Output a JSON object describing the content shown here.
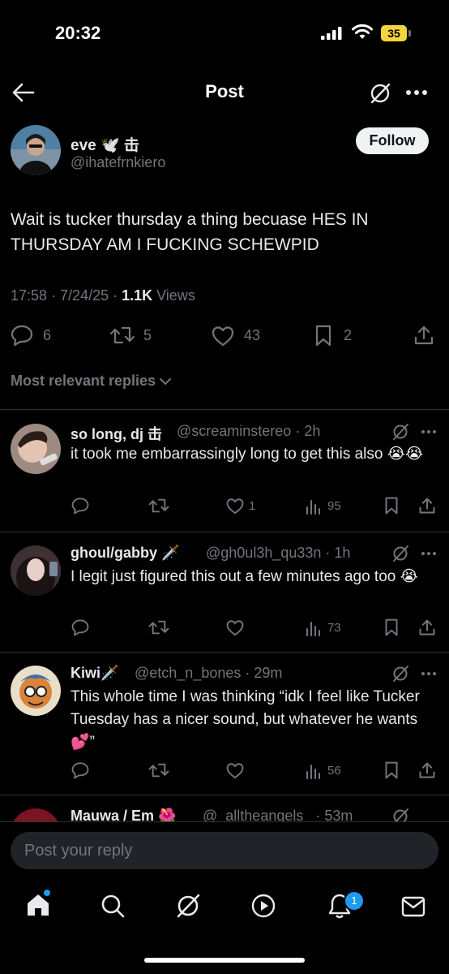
{
  "status_bar": {
    "time": "20:32",
    "battery": "35"
  },
  "header": {
    "title": "Post"
  },
  "post": {
    "name": "eve 🕊️ 击",
    "handle": "@ihatefrnkiero",
    "follow_label": "Follow",
    "text": "Wait is tucker thursday a thing becuase HES IN THURSDAY AM I FUCKING SCHEWPID",
    "timestamp": "17:58 · 7/24/25 · ",
    "views_count": "1.1K",
    "views_label": " Views",
    "stats": {
      "replies": "6",
      "reposts": "5",
      "likes": "43",
      "bookmarks": "2"
    }
  },
  "sort": {
    "label": "Most relevant replies"
  },
  "replies": [
    {
      "name": "so long, dj 击",
      "handle": "@screaminstereo · 2h",
      "text": "it took me embarrassingly long to get this also 😭😭",
      "likes": "1",
      "views": "95"
    },
    {
      "name": "ghoul/gabby 🗡️",
      "handle": "@gh0ul3h_qu33n · 1h",
      "text": "I legit just figured this out a few minutes ago too 😭",
      "likes": "",
      "views": "73"
    },
    {
      "name": "Kiwi🗡️",
      "handle": "@etch_n_bones · 29m",
      "text": "This whole time I was thinking “idk I feel like Tucker Tuesday has a nicer sound, but whatever he wants💕”",
      "likes": "",
      "views": "56"
    },
    {
      "name": "Mauwa / Em 🌺",
      "handle": "@_alltheangels_ · 53m"
    }
  ],
  "compose": {
    "placeholder": "Post your reply"
  },
  "nav": {
    "notifications_badge": "1"
  },
  "colors": {
    "accent": "#1d9bf0",
    "background": "#000000",
    "muted": "#71767b",
    "follow_bg": "#eff3f4"
  }
}
